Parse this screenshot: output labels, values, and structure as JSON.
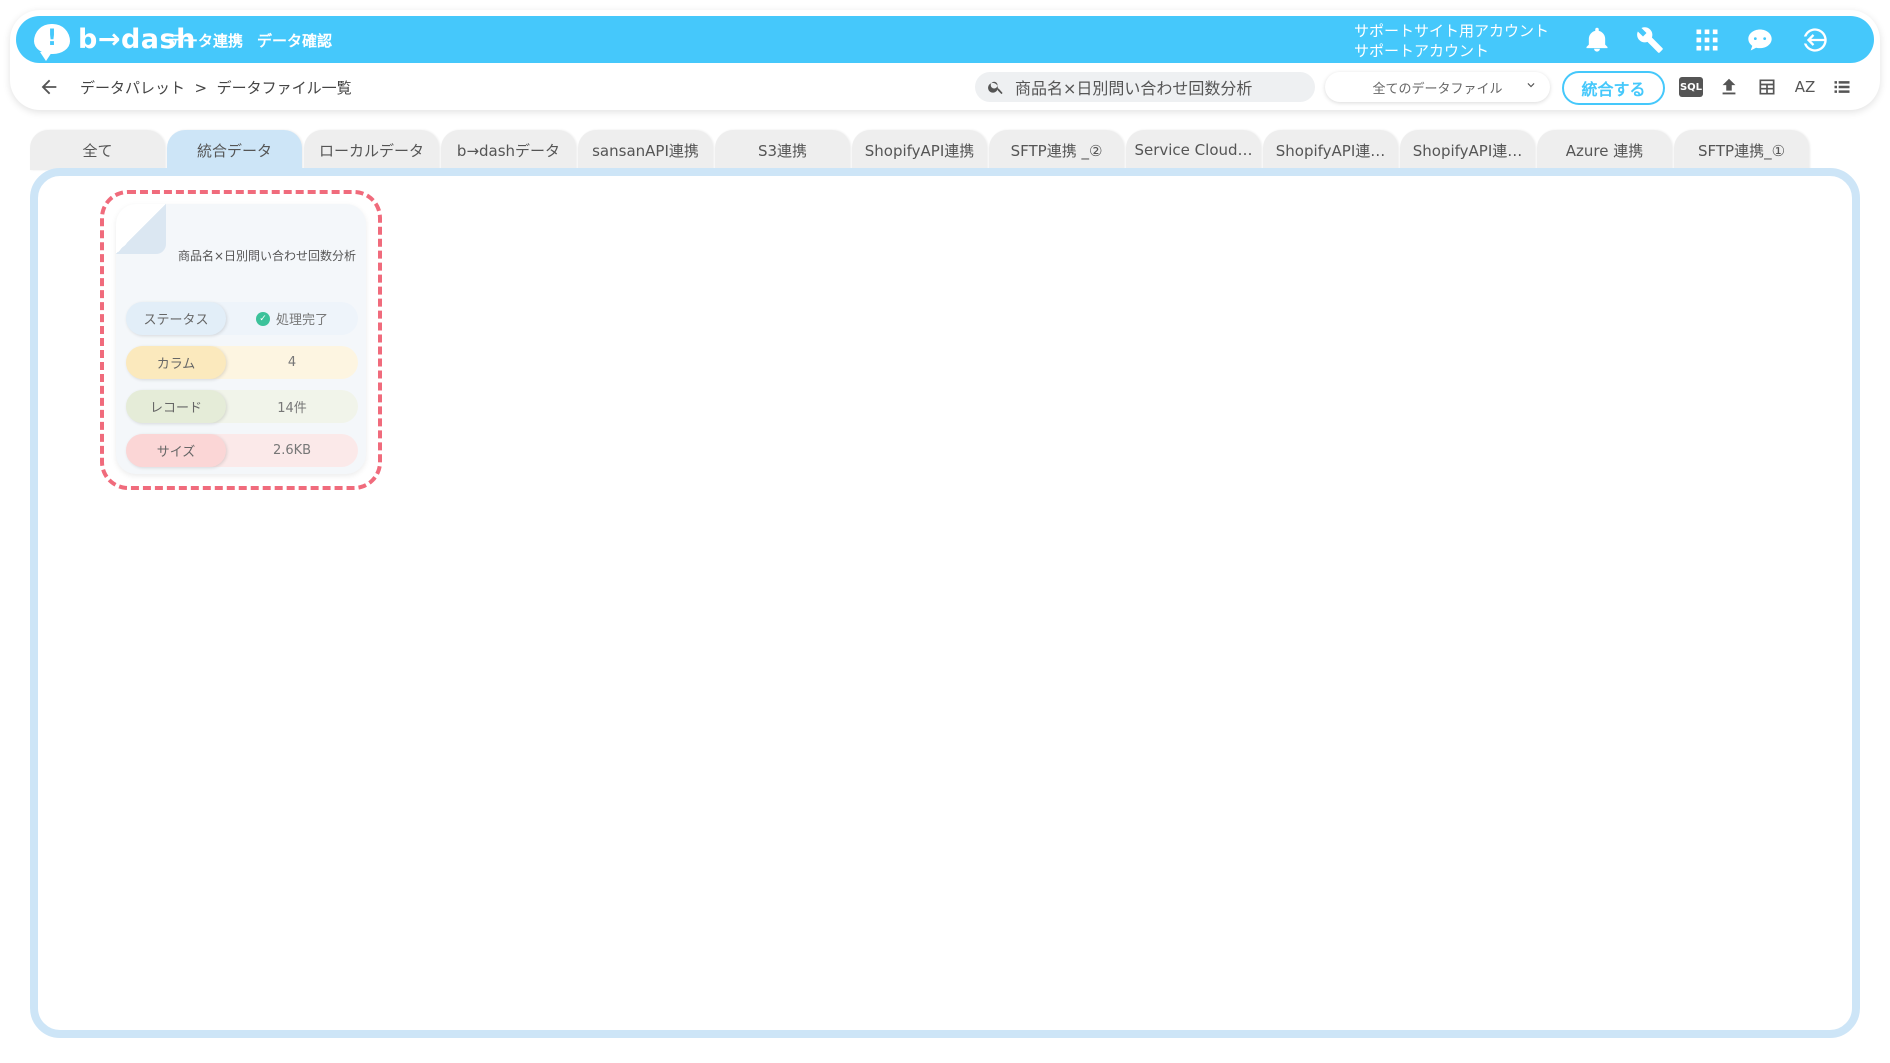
{
  "header": {
    "logo_text": "b→dash",
    "nav": [
      "データ連携",
      "データ確認"
    ],
    "account_line1": "サポートサイト用アカウント",
    "account_line2": "サポートアカウント"
  },
  "subbar": {
    "breadcrumb": "データパレット  >  データファイル一覧",
    "search_value": "商品名×日別問い合わせ回数分析",
    "file_select": "全てのデータファイル",
    "merge_button": "統合する",
    "sql_label": "SQL",
    "sort_label": "AZ"
  },
  "tabs": [
    {
      "label": "全て"
    },
    {
      "label": "統合データ"
    },
    {
      "label": "ローカルデータ"
    },
    {
      "label": "b→dashデータ"
    },
    {
      "label": "sansanAPI連携"
    },
    {
      "label": "S3連携"
    },
    {
      "label": "ShopifyAPI連携"
    },
    {
      "label": "SFTP連携 _②"
    },
    {
      "label": "Service Cloud…"
    },
    {
      "label": "ShopifyAPI連…"
    },
    {
      "label": "ShopifyAPI連…"
    },
    {
      "label": "Azure 連携"
    },
    {
      "label": "SFTP連携_①"
    }
  ],
  "active_tab": "統合データ",
  "file_card": {
    "title": "商品名×日別問い合わせ回数分析",
    "rows": [
      {
        "label": "ステータス",
        "value": "処理完了",
        "label_color": "#e2eef8",
        "value_color": "#eef4fa"
      },
      {
        "label": "カラム",
        "value": "4",
        "label_color": "#fbe9bd",
        "value_color": "#fdf5e1"
      },
      {
        "label": "レコード",
        "value": "14件",
        "label_color": "#e5ecd8",
        "value_color": "#f1f4ea"
      },
      {
        "label": "サイズ",
        "value": "2.6KB",
        "label_color": "#fbd6d6",
        "value_color": "#fbe9e9"
      }
    ]
  },
  "colors": {
    "brand": "#45c8fb",
    "tab_active": "#cde5f7",
    "highlight": "#f06b7c",
    "status_ok": "#3cc29a"
  }
}
